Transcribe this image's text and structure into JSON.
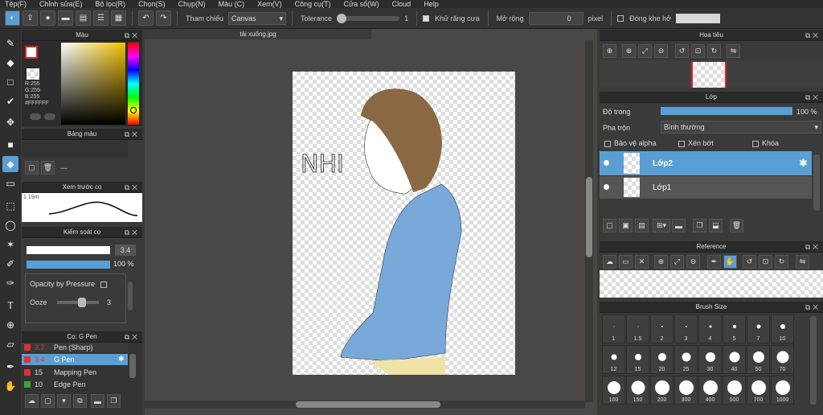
{
  "menu": [
    "Tệp(F)",
    "Chỉnh sửa(E)",
    "Bộ lọc(R)",
    "Chọn(S)",
    "Chụp(N)",
    "Màu (C)",
    "Xem(V)",
    "Công cụ(T)",
    "Cửa sổ(W)",
    "Cloud",
    "Help"
  ],
  "toolbar": {
    "ref_label": "Tham chiếu",
    "ref_value": "Canvas",
    "tolerance_label": "Tolerance",
    "tolerance_value": "1",
    "antialias_label": "Khử răng cưa",
    "expand_label": "Mở rộng",
    "expand_value": "0",
    "pixel_label": "pixel",
    "gapclose_label": "Đóng khe hở"
  },
  "color_panel": {
    "title": "Màu",
    "r": "R:255",
    "g": "G:255",
    "b": "B:255",
    "hex": "#FFFFFF"
  },
  "palette_panel": {
    "title": "Bảng màu",
    "text": "---"
  },
  "brush_preview": {
    "title": "Xem trước cọ",
    "size": "1.19m"
  },
  "brush_control": {
    "title": "Kiểm soát cọ",
    "size_value": "3.4",
    "opacity_value": "100 %",
    "pressure_label": "Opacity by Pressure",
    "ooze_label": "Ooze",
    "ooze_value": "3"
  },
  "brush_list": {
    "title": "Cọ: G Pen",
    "items": [
      {
        "size": "3.7",
        "name": "Pen (Sharp)",
        "color": "#d33"
      },
      {
        "size": "3.4",
        "name": "G Pen",
        "color": "#d33"
      },
      {
        "size": "15",
        "name": "Mapping Pen",
        "color": "#d33"
      },
      {
        "size": "10",
        "name": "Edge Pen",
        "color": "#3a3"
      }
    ]
  },
  "canvas": {
    "tab": "tải xuống.jpg",
    "handwriting": "NHI"
  },
  "navigator": {
    "title": "Hoa tiêu"
  },
  "layers": {
    "title": "Lớp",
    "opacity_label": "Độ trong",
    "opacity_value": "100 %",
    "opacity_fraction": 1.0,
    "blend_label": "Pha trộn",
    "blend_value": "Bình thường",
    "protect_alpha": "Bảo vệ alpha",
    "clipping": "Xén bớt",
    "lock": "Khóa",
    "items": [
      {
        "name": "Lớp2",
        "selected": true
      },
      {
        "name": "Lớp1",
        "selected": false
      }
    ]
  },
  "reference": {
    "title": "Reference"
  },
  "brush_size": {
    "title": "Brush Size",
    "sizes": [
      "1",
      "1.5",
      "2",
      "3",
      "4",
      "5",
      "7",
      "10",
      "12",
      "15",
      "20",
      "25",
      "30",
      "40",
      "50",
      "70",
      "100",
      "150",
      "200",
      "300",
      "400",
      "500",
      "700",
      "1000"
    ]
  }
}
